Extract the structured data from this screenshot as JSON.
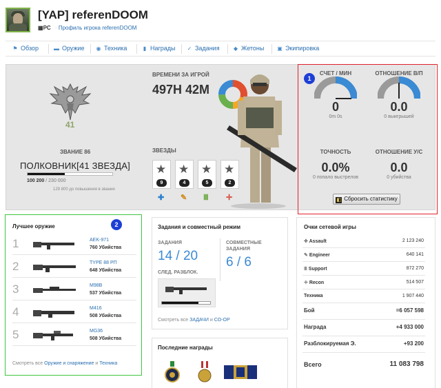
{
  "header": {
    "title": "[YAP] referenDOOM",
    "platform": "PC",
    "profile_link": "Профиль игрока referenDOOM"
  },
  "nav": {
    "items": [
      {
        "label": "Обзор",
        "icon": "bookmark-icon"
      },
      {
        "label": "Оружие",
        "icon": "gun-icon"
      },
      {
        "label": "Техника",
        "icon": "vehicle-icon"
      },
      {
        "label": "Награды",
        "icon": "medal-icon"
      },
      {
        "label": "Задания",
        "icon": "check-icon"
      },
      {
        "label": "Жетоны",
        "icon": "dogtag-icon"
      },
      {
        "label": "Экипировка",
        "icon": "lock-icon"
      }
    ]
  },
  "rank": {
    "number": "41",
    "label": "ЗВАНИЕ 86",
    "name": "ПОЛКОВНИК[41 ЗВЕЗДА]",
    "xp_current": "100 200",
    "xp_total": "/ 230 000",
    "progress": 0.44,
    "xp_note": "129 800 до повышения в звании"
  },
  "playtime": {
    "label": "ВРЕМЕНИ ЗА ИГРОЙ",
    "value": "497H 42M"
  },
  "stars": {
    "label": "ЗВЕЗДЫ",
    "items": [
      {
        "count": "9",
        "class": "assault-icon",
        "color": "#2a7fd0"
      },
      {
        "count": "4",
        "class": "wrench-icon",
        "color": "#d08a1a"
      },
      {
        "count": "5",
        "class": "ammo-icon",
        "color": "#5aa02c"
      },
      {
        "count": "2",
        "class": "recon-icon",
        "color": "#d24a3a"
      }
    ]
  },
  "stats_panel": {
    "badge": "1",
    "score": {
      "label": "СЧЕТ / МИН",
      "value": "0",
      "sub": "0m 0s"
    },
    "wl": {
      "label": "ОТНОШЕНИЕ В/П",
      "value": "0.0",
      "sub": "0 выигрышей"
    },
    "accuracy": {
      "label": "ТОЧНОСТЬ",
      "value": "0.0%",
      "sub": "0 попало выстрелов"
    },
    "kd": {
      "label": "ОТНОШЕНИЕ У/С",
      "value": "0.0",
      "sub": "0 убийства"
    },
    "reset_button": "Сбросить статистику"
  },
  "weapons": {
    "title": "Лучшее оружие",
    "badge": "2",
    "items": [
      {
        "rank": "1",
        "name": "AEK-971",
        "kills": "760 Убийства"
      },
      {
        "rank": "2",
        "name": "TYPE 88 РП",
        "kills": "648 Убийства"
      },
      {
        "rank": "3",
        "name": "M98B",
        "kills": "537 Убийства"
      },
      {
        "rank": "4",
        "name": "M416",
        "kills": "508 Убийства"
      },
      {
        "rank": "5",
        "name": "MG36",
        "kills": "508 Убийства"
      }
    ],
    "footer_prefix": "Смотреть все",
    "footer_link1": "Оружие и снаряжение",
    "footer_or": "и",
    "footer_link2": "Техника"
  },
  "tasks": {
    "title": "Задания и совместный режим",
    "tasks_label": "ЗАДАНИЯ",
    "tasks_value": "14 / 20",
    "coop_label1": "СОВМЕСТНЫЕ",
    "coop_label2": "ЗАДАНИЯ",
    "coop_value": "6 / 6",
    "unlock_label": "СЛЕД. РАЗБЛОК.",
    "unlock_progress": 0.75,
    "footer_prefix": "Смотреть все",
    "footer_link1": "ЗАДАЧИ",
    "footer_or": "и",
    "footer_link2": "CO-OP"
  },
  "awards": {
    "title": "Последние награды"
  },
  "score": {
    "title": "Очки сетевой игры",
    "classes": [
      {
        "label": "Assault",
        "value": "2 123 240",
        "icon": "assault-icon"
      },
      {
        "label": "Engineer",
        "value": "640 141",
        "icon": "wrench-icon"
      },
      {
        "label": "Support",
        "value": "872 270",
        "icon": "ammo-icon"
      },
      {
        "label": "Recon",
        "value": "514 507",
        "icon": "recon-icon"
      }
    ],
    "vehicles": {
      "label": "Техника",
      "value": "1 907 440"
    },
    "combat": {
      "label": "Бой",
      "value": "=6 057 598"
    },
    "awards": {
      "label": "Награда",
      "value": "+4 933 000"
    },
    "unlocks": {
      "label": "Разблокируемая Э.",
      "value": "+93 200"
    },
    "total": {
      "label": "Всего",
      "value": "11 083 798"
    }
  }
}
